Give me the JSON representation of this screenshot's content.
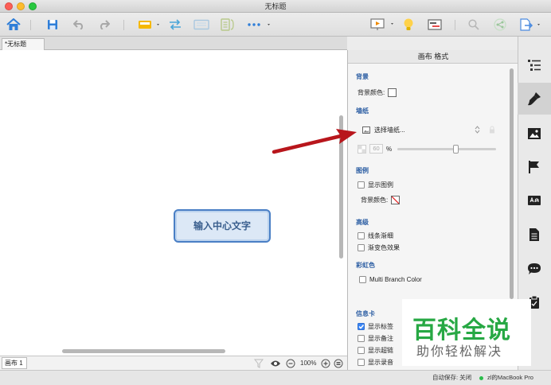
{
  "window": {
    "title": "无标题"
  },
  "tabs": {
    "document_tab": "*无标题",
    "sheet_tab": "画布 1"
  },
  "canvas": {
    "central_topic": "输入中心文字"
  },
  "zoom": {
    "level": "100%"
  },
  "status": {
    "autosave": "自动保存: 关闭",
    "device": "zl的MacBook Pro"
  },
  "inspector": {
    "title": "画布 格式",
    "background": {
      "heading": "背景",
      "color_label": "背景颜色:"
    },
    "wallpaper": {
      "heading": "墙纸",
      "select_label": "选择墙纸...",
      "opacity_value": "60",
      "opacity_unit": "%"
    },
    "legend": {
      "heading": "图例",
      "show_label": "显示图例",
      "color_label": "背景颜色:"
    },
    "advanced": {
      "heading": "高级",
      "line_taper": "线条渐细",
      "gradient": "渐变色效果"
    },
    "rainbow": {
      "heading": "彩虹色",
      "multi_branch": "Multi Branch Color"
    },
    "info_card": {
      "heading": "信息卡",
      "items": [
        "显示标签",
        "显示备注",
        "显示超链",
        "显示录音"
      ]
    }
  },
  "watermark": {
    "title": "百科全说",
    "subtitle": "助你轻松解决"
  },
  "colors": {
    "accent": "#2c5ea3",
    "topic_border": "#4a7fc5",
    "arrow": "#b8161c",
    "watermark": "#27a844"
  }
}
